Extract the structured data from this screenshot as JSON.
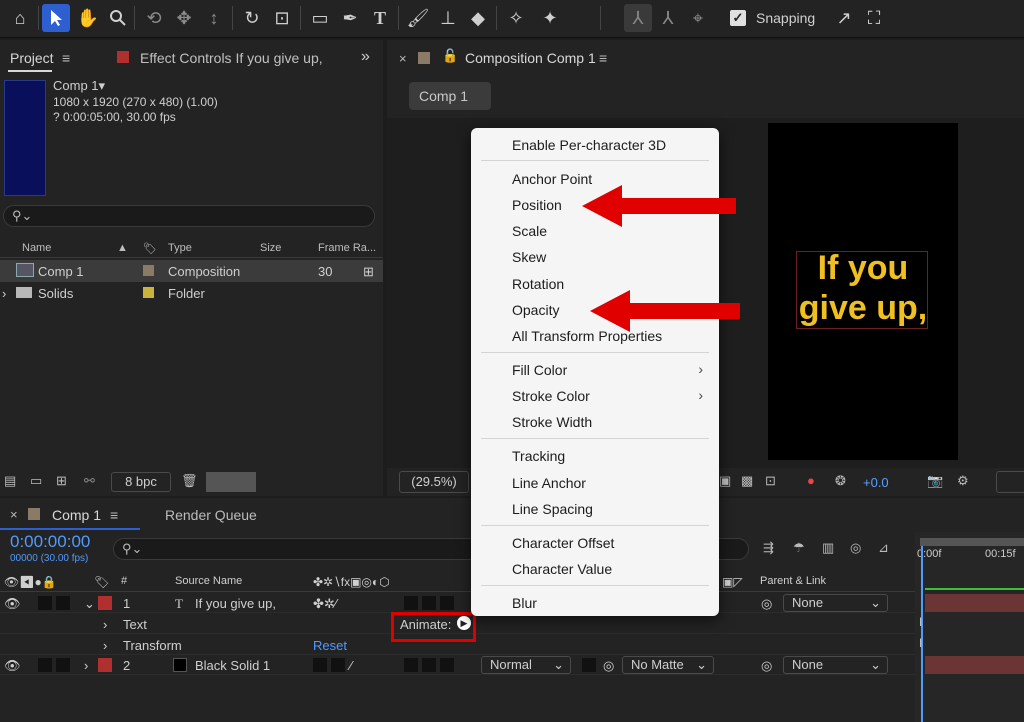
{
  "toolbar": {
    "tools": [
      "home-icon",
      "selection-tool-icon",
      "hand-tool-icon",
      "zoom-tool-icon",
      "orbit-tool-icon",
      "pan-tool-icon",
      "dolly-tool-icon",
      "rotation-tool-icon",
      "pan-behind-tool-icon",
      "rectangle-tool-icon",
      "pen-tool-icon",
      "type-tool-icon",
      "brush-tool-icon",
      "clone-stamp-tool-icon",
      "eraser-tool-icon",
      "roto-brush-tool-icon",
      "puppet-tool-icon"
    ],
    "snapping_label": "Snapping"
  },
  "project": {
    "tab_label": "Project",
    "effect_controls_label": "Effect Controls If you give up,",
    "item_name": "Comp 1",
    "item_resolution": "1080 x 1920  (270 x 480) (1.00)",
    "item_duration": "? 0:00:05:00, 30.00 fps",
    "columns": {
      "name": "Name",
      "type": "Type",
      "size": "Size",
      "frame_rate": "Frame Ra..."
    },
    "rows": [
      {
        "name": "Comp 1",
        "type": "Composition",
        "frame_rate": "30",
        "label_color": "#8a7a66"
      },
      {
        "name": "Solids",
        "type": "Folder",
        "frame_rate": "",
        "label_color": "#c8b43a"
      }
    ],
    "bpc": "8 bpc"
  },
  "composition": {
    "tab_label": "Composition Comp 1",
    "chip_label": "Comp 1",
    "canvas_text_line1": "If you",
    "canvas_text_line2": "give up,",
    "zoom": "(29.5%)",
    "exposure": "+0.0"
  },
  "timeline": {
    "tab_label": "Comp 1",
    "render_queue_label": "Render Queue",
    "timecode": "0:00:00:00",
    "fps": "00000 (30.00 fps)",
    "columns": {
      "number": "#",
      "source_name": "Source Name",
      "parent_link": "Parent & Link"
    },
    "layers": [
      {
        "number": "1",
        "name": "If you give up,",
        "parent": "None",
        "label_color": "#b03030"
      },
      {
        "number": "2",
        "name": "Black Solid 1",
        "mode": "Normal",
        "matte": "No Matte",
        "parent": "None",
        "label_color": "#b03030"
      }
    ],
    "text_group_label": "Text",
    "transform_group_label": "Transform",
    "reset_label": "Reset",
    "animate_label": "Animate:",
    "ruler_start": "0:00f",
    "ruler_mark": "00:15f"
  },
  "context_menu": {
    "groups": [
      [
        "Enable Per-character 3D"
      ],
      [
        "Anchor Point",
        "Position",
        "Scale",
        "Skew",
        "Rotation",
        "Opacity",
        "All Transform Properties"
      ],
      [
        "Fill Color",
        "Stroke Color",
        "Stroke Width"
      ],
      [
        "Tracking",
        "Line Anchor",
        "Line Spacing"
      ],
      [
        "Character Offset",
        "Character Value"
      ],
      [
        "Blur"
      ]
    ]
  },
  "annotations": {
    "arrow_color": "#e00000"
  }
}
